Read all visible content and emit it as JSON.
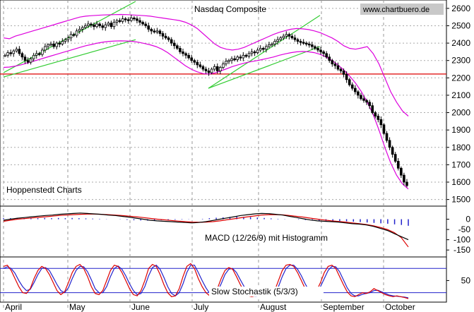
{
  "watermark": "www.chartbuero.de",
  "publisher": "Hoppenstedt Charts",
  "colors": {
    "bollinger": "#dd00dd",
    "channel": "#33cc33",
    "support": "#dd0000",
    "macd": "#000000",
    "signal": "#dd0000",
    "histogram": "#2222cc",
    "stoch_k": "#dd0000",
    "stoch_d": "#2222cc",
    "level": "#2222cc"
  },
  "chart_data": [
    {
      "type": "candlestick",
      "title": "Nasdaq Composite",
      "y_ticks": [
        1500,
        1600,
        1700,
        1800,
        1900,
        2000,
        2100,
        2200,
        2300,
        2400,
        2500,
        2600
      ],
      "ylim": [
        1470,
        2640
      ],
      "x_months": [
        "April",
        "May",
        "June",
        "July",
        "August",
        "September",
        "October"
      ],
      "close": [
        2330,
        2345,
        2340,
        2355,
        2365,
        2340,
        2320,
        2300,
        2290,
        2310,
        2330,
        2340,
        2335,
        2360,
        2380,
        2390,
        2395,
        2380,
        2400,
        2395,
        2410,
        2420,
        2430,
        2450,
        2445,
        2470,
        2480,
        2490,
        2500,
        2510,
        2505,
        2495,
        2510,
        2500,
        2490,
        2505,
        2515,
        2495,
        2520,
        2530,
        2525,
        2540,
        2535,
        2530,
        2545,
        2540,
        2530,
        2520,
        2510,
        2500,
        2480,
        2470,
        2465,
        2470,
        2455,
        2440,
        2430,
        2420,
        2400,
        2385,
        2370,
        2350,
        2340,
        2330,
        2315,
        2300,
        2290,
        2275,
        2265,
        2250,
        2240,
        2230,
        2250,
        2265,
        2240,
        2260,
        2280,
        2295,
        2300,
        2310,
        2305,
        2320,
        2315,
        2330,
        2325,
        2340,
        2350,
        2345,
        2360,
        2370,
        2365,
        2380,
        2390,
        2395,
        2410,
        2420,
        2430,
        2440,
        2450,
        2440,
        2430,
        2420,
        2410,
        2405,
        2400,
        2395,
        2390,
        2380,
        2370,
        2360,
        2350,
        2340,
        2320,
        2300,
        2280,
        2270,
        2250,
        2240,
        2220,
        2190,
        2160,
        2140,
        2120,
        2100,
        2080,
        2070,
        2060,
        2040,
        2000,
        1980,
        1960,
        1930,
        1880,
        1840,
        1800,
        1760,
        1720,
        1680,
        1640,
        1600,
        1580
      ],
      "bollinger_upper": [
        2430,
        2425,
        2440,
        2450,
        2460,
        2470,
        2480,
        2490,
        2500,
        2510,
        2520,
        2530,
        2540,
        2550,
        2555,
        2558,
        2560,
        2562,
        2563,
        2564,
        2565,
        2564,
        2562,
        2560,
        2558,
        2555,
        2550,
        2545,
        2540,
        2535,
        2530,
        2520,
        2505,
        2485,
        2455,
        2425,
        2395,
        2375,
        2365,
        2360,
        2365,
        2375,
        2390,
        2405,
        2420,
        2435,
        2450,
        2462,
        2472,
        2480,
        2484,
        2482,
        2478,
        2470,
        2460,
        2445,
        2430,
        2410,
        2385,
        2370,
        2365,
        2372,
        2380,
        2340,
        2280,
        2200,
        2120,
        2060,
        2010,
        1980
      ],
      "bollinger_lower": [
        2260,
        2262,
        2268,
        2275,
        2285,
        2295,
        2305,
        2315,
        2325,
        2335,
        2345,
        2355,
        2365,
        2375,
        2385,
        2392,
        2400,
        2406,
        2410,
        2412,
        2413,
        2412,
        2410,
        2405,
        2398,
        2390,
        2380,
        2365,
        2345,
        2320,
        2295,
        2270,
        2250,
        2235,
        2225,
        2222,
        2228,
        2240,
        2252,
        2265,
        2275,
        2285,
        2292,
        2298,
        2305,
        2312,
        2320,
        2330,
        2338,
        2345,
        2350,
        2352,
        2350,
        2345,
        2335,
        2320,
        2300,
        2275,
        2245,
        2210,
        2170,
        2120,
        2060,
        1990,
        1900,
        1800,
        1710,
        1640,
        1590,
        1560
      ],
      "channels": [
        {
          "from": [
            5,
            2230
          ],
          "to": [
            192,
            2640
          ]
        },
        {
          "from": [
            5,
            2205
          ],
          "to": [
            192,
            2420
          ]
        },
        {
          "from": [
            295,
            2140
          ],
          "to": [
            453,
            2560
          ]
        },
        {
          "from": [
            295,
            2140
          ],
          "to": [
            453,
            2380
          ]
        }
      ],
      "support_level": 2222,
      "y_labels_axis": "right"
    },
    {
      "type": "line",
      "title": "MACD (12/26/9) mit Histogramm",
      "y_ticks": [
        -150,
        -100,
        -50,
        0
      ],
      "ylim": [
        -170,
        50
      ],
      "macd": [
        -5,
        0,
        5,
        8,
        12,
        15,
        18,
        20,
        24,
        26,
        28,
        30,
        28,
        26,
        24,
        20,
        18,
        14,
        10,
        5,
        0,
        -5,
        -8,
        -10,
        -12,
        -14,
        -16,
        -18,
        -16,
        -12,
        -6,
        0,
        6,
        12,
        18,
        22,
        26,
        28,
        27,
        24,
        20,
        14,
        8,
        2,
        -4,
        -8,
        -10,
        -12,
        -14,
        -18,
        -22,
        -24,
        -28,
        -35,
        -45,
        -55,
        -70,
        -85,
        -100
      ],
      "signal": [
        -10,
        -5,
        0,
        3,
        6,
        9,
        12,
        15,
        18,
        20,
        22,
        24,
        25,
        25,
        24,
        22,
        20,
        18,
        15,
        12,
        8,
        4,
        0,
        -3,
        -6,
        -9,
        -12,
        -14,
        -15,
        -14,
        -12,
        -8,
        -3,
        2,
        7,
        12,
        16,
        20,
        22,
        22,
        21,
        18,
        14,
        10,
        5,
        0,
        -4,
        -8,
        -11,
        -14,
        -18,
        -22,
        -26,
        -32,
        -40,
        -50,
        -65,
        -90,
        -135
      ],
      "histogram": [
        5,
        5,
        4,
        5,
        4,
        5,
        6,
        5,
        6,
        5,
        6,
        5,
        4,
        3,
        2,
        1,
        0,
        -1,
        -3,
        -5,
        -6,
        -7,
        -6,
        -5,
        -4,
        -3,
        -2,
        -1,
        0,
        2,
        5,
        7,
        9,
        11,
        12,
        11,
        10,
        8,
        6,
        4,
        2,
        1,
        0,
        -2,
        -4,
        -6,
        -7,
        -8,
        -8,
        -9,
        -10,
        -12,
        -14,
        -16,
        -18,
        -20,
        -22,
        -25,
        -28,
        -32
      ]
    },
    {
      "type": "line",
      "title": "Slow Stochastik (5/3/3)",
      "y_ticks": [
        50
      ],
      "ylim": [
        0,
        105
      ],
      "levels": [
        20,
        80
      ],
      "k": [
        85,
        88,
        75,
        55,
        35,
        20,
        18,
        30,
        55,
        75,
        85,
        80,
        65,
        45,
        25,
        15,
        22,
        45,
        70,
        85,
        90,
        80,
        60,
        35,
        18,
        15,
        25,
        50,
        75,
        88,
        85,
        70,
        50,
        30,
        15,
        12,
        25,
        50,
        80,
        90,
        85,
        65,
        40,
        20,
        10,
        12,
        30,
        60,
        85,
        92,
        80,
        55,
        35,
        20,
        12,
        15,
        30,
        55,
        75,
        82,
        78,
        60,
        40,
        22,
        12,
        10,
        12,
        15,
        13,
        12,
        15,
        25,
        50,
        75,
        88,
        90,
        85,
        70,
        50,
        30,
        18,
        15,
        25,
        45,
        70,
        85,
        88,
        80,
        60,
        40,
        22,
        12,
        10,
        15,
        20,
        18,
        22,
        30,
        25,
        20,
        15,
        12,
        10,
        12,
        10,
        8,
        5
      ],
      "d": [
        80,
        84,
        80,
        68,
        50,
        35,
        25,
        28,
        45,
        65,
        80,
        82,
        75,
        58,
        40,
        25,
        20,
        32,
        55,
        75,
        85,
        84,
        72,
        52,
        30,
        20,
        20,
        35,
        60,
        80,
        86,
        78,
        62,
        42,
        25,
        15,
        18,
        35,
        62,
        82,
        88,
        78,
        58,
        35,
        18,
        12,
        20,
        42,
        70,
        88,
        88,
        70,
        50,
        32,
        18,
        14,
        22,
        42,
        65,
        78,
        80,
        70,
        52,
        35,
        20,
        12,
        11,
        12,
        13,
        13,
        14,
        20,
        35,
        60,
        80,
        88,
        88,
        78,
        62,
        42,
        25,
        18,
        20,
        35,
        55,
        75,
        85,
        84,
        72,
        52,
        32,
        18,
        12,
        12,
        16,
        18,
        20,
        25,
        26,
        22,
        18,
        14,
        12,
        11,
        10,
        9,
        7
      ]
    }
  ]
}
